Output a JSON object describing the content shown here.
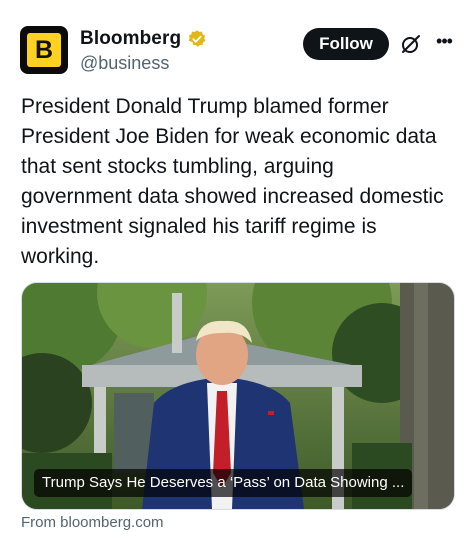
{
  "account": {
    "logo_letter": "B",
    "display_name": "Bloomberg",
    "handle": "@business"
  },
  "actions": {
    "follow_label": "Follow",
    "more_label": "•••"
  },
  "tweet": {
    "text": "President Donald Trump blamed former\nPresident Joe Biden for weak economic data\nthat sent stocks tumbling, arguing\ngovernment data showed increased domestic\ninvestment signaled his tariff regime is\nworking."
  },
  "card": {
    "caption": "Trump Says He Deserves a ‘Pass’ on Data Showing ...",
    "source": "From bloomberg.com"
  },
  "colors": {
    "logo_bg": "#0b0b0b",
    "logo_fg": "#ffd21f",
    "verified_badge": "#e2b719",
    "follow_bg": "#0f1419",
    "secondary_text": "#536471"
  }
}
